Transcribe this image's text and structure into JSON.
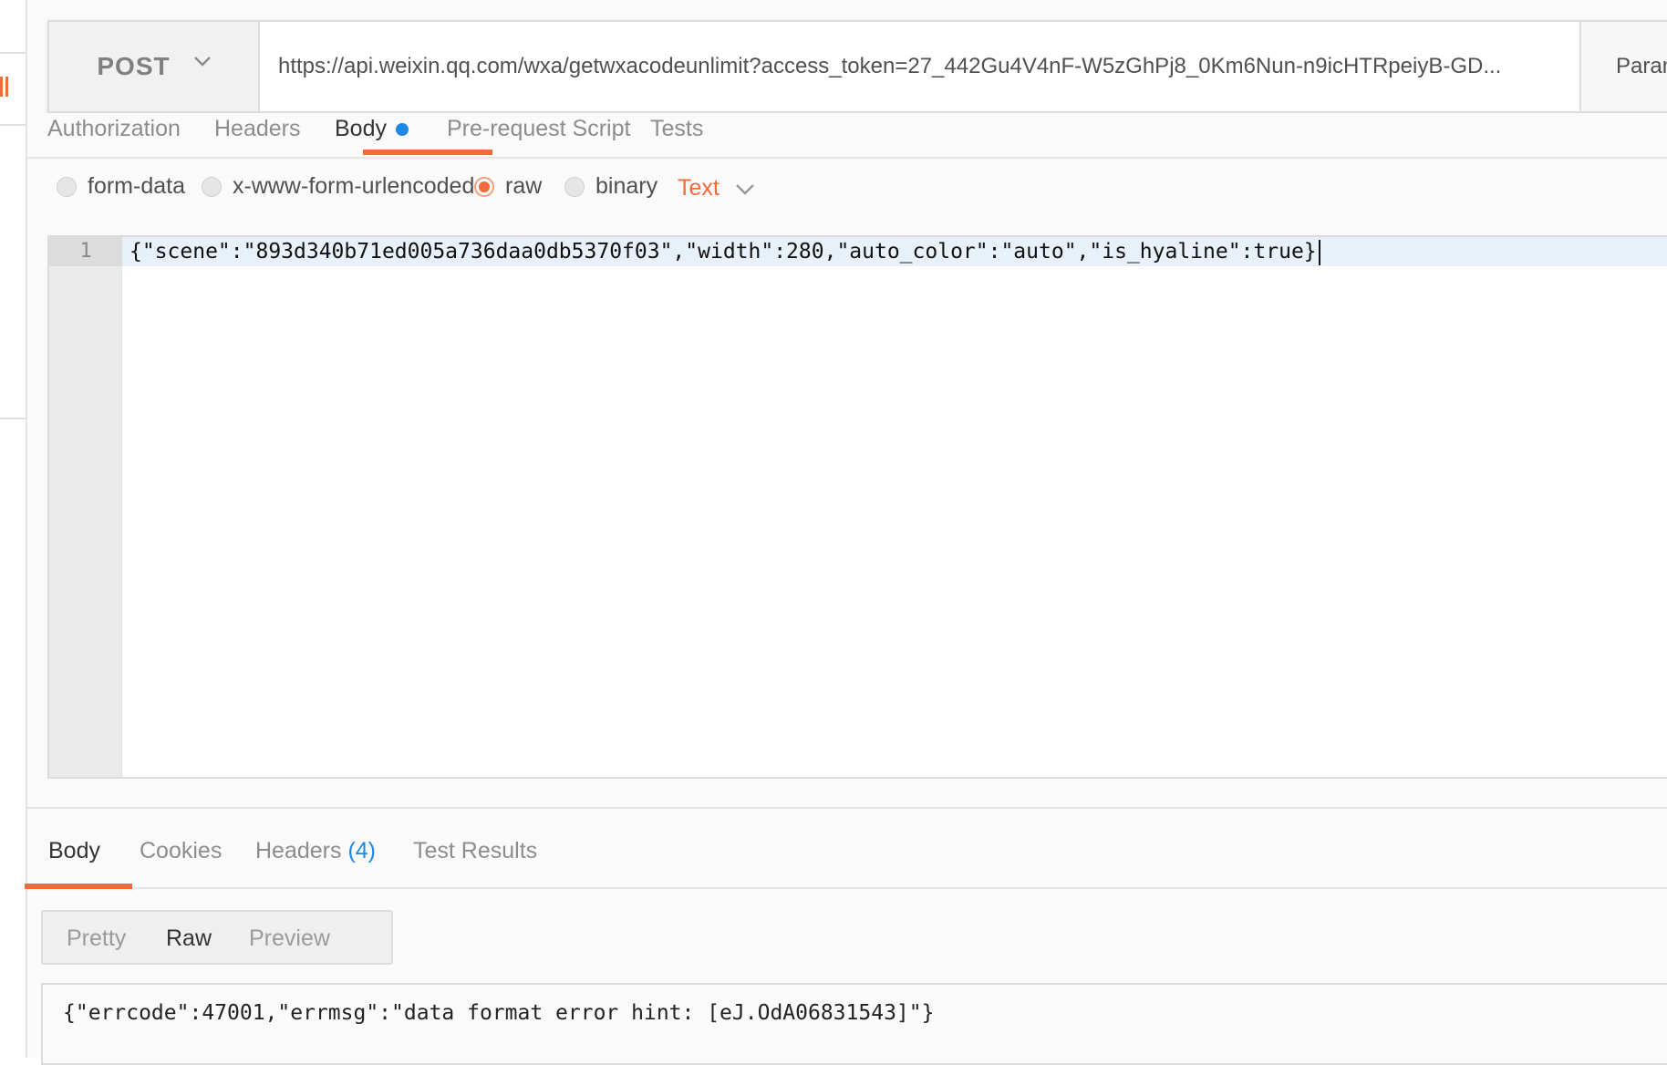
{
  "request": {
    "method": "POST",
    "url": "https://api.weixin.qq.com/wxa/getwxacodeunlimit?access_token=27_442Gu4V4nF-W5zGhPj8_0Km6Nun-n9icHTRpeiyB-GD...",
    "params_label": "Params"
  },
  "request_tabs": [
    {
      "label": "Authorization"
    },
    {
      "label": "Headers"
    },
    {
      "label": "Body"
    },
    {
      "label": "Pre-request Script"
    },
    {
      "label": "Tests"
    }
  ],
  "body_types": {
    "options": [
      "form-data",
      "x-www-form-urlencoded",
      "raw",
      "binary"
    ],
    "selected": "raw",
    "format": "Text"
  },
  "editor": {
    "line_number": "1",
    "content": "{\"scene\":\"893d340b71ed005a736daa0db5370f03\",\"width\":280,\"auto_color\":\"auto\",\"is_hyaline\":true}"
  },
  "response_tabs": {
    "body": "Body",
    "cookies": "Cookies",
    "headers": "Headers",
    "headers_count": "(4)",
    "test_results": "Test Results"
  },
  "view_modes": [
    "Pretty",
    "Raw",
    "Preview"
  ],
  "active_view": "Raw",
  "response_body": "{\"errcode\":47001,\"errmsg\":\"data format error hint: [eJ.OdA06831543]\"}",
  "colors": {
    "accent": "#f26b3a",
    "blue_dot": "#1e88e5"
  }
}
